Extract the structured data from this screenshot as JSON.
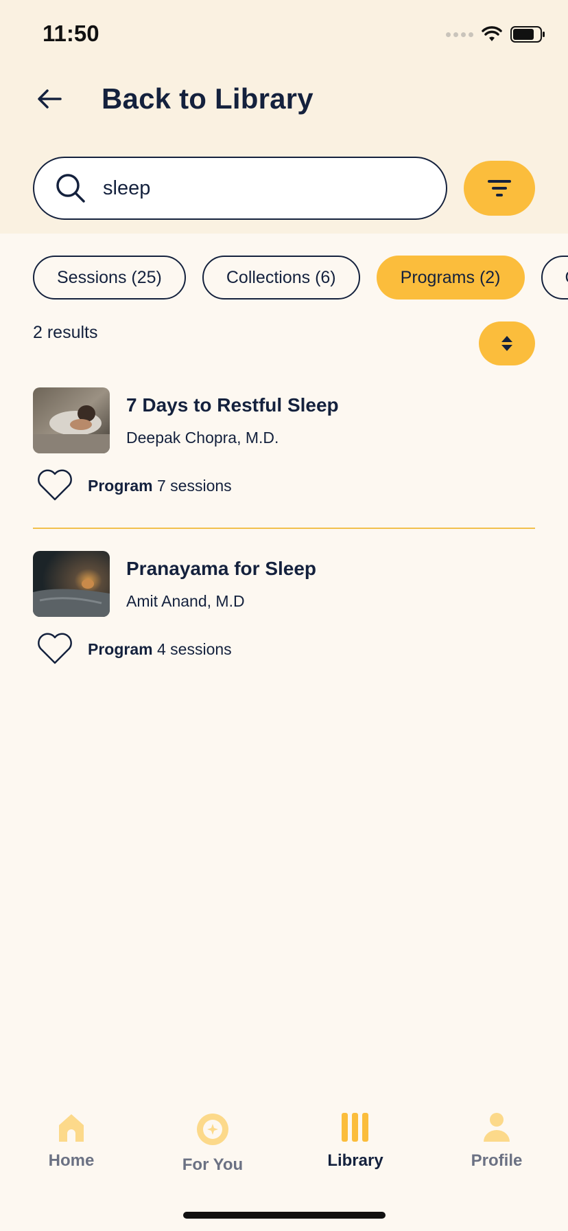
{
  "status_bar": {
    "time": "11:50"
  },
  "header": {
    "title": "Back to Library"
  },
  "search": {
    "value": "sleep"
  },
  "chips": [
    {
      "label": "Sessions (25)",
      "active": false
    },
    {
      "label": "Collections (6)",
      "active": false
    },
    {
      "label": "Programs (2)",
      "active": true
    },
    {
      "label": "C",
      "active": false
    }
  ],
  "results": {
    "count_label": "2 results",
    "items": [
      {
        "title": "7 Days to Restful Sleep",
        "author": "Deepak Chopra, M.D.",
        "type": "Program",
        "sessions": "7 sessions"
      },
      {
        "title": "Pranayama for Sleep",
        "author": "Amit Anand, M.D",
        "type": "Program",
        "sessions": "4 sessions"
      }
    ]
  },
  "tabbar": {
    "items": [
      {
        "label": "Home",
        "icon": "home-icon",
        "active": false
      },
      {
        "label": "For You",
        "icon": "for-you-icon",
        "active": false
      },
      {
        "label": "Library",
        "icon": "library-icon",
        "active": true
      },
      {
        "label": "Profile",
        "icon": "profile-icon",
        "active": false
      }
    ]
  },
  "colors": {
    "accent": "#fbbd3c",
    "navy": "#14213d",
    "header_bg": "#faf1e1",
    "page_bg": "#fdf8f1"
  }
}
